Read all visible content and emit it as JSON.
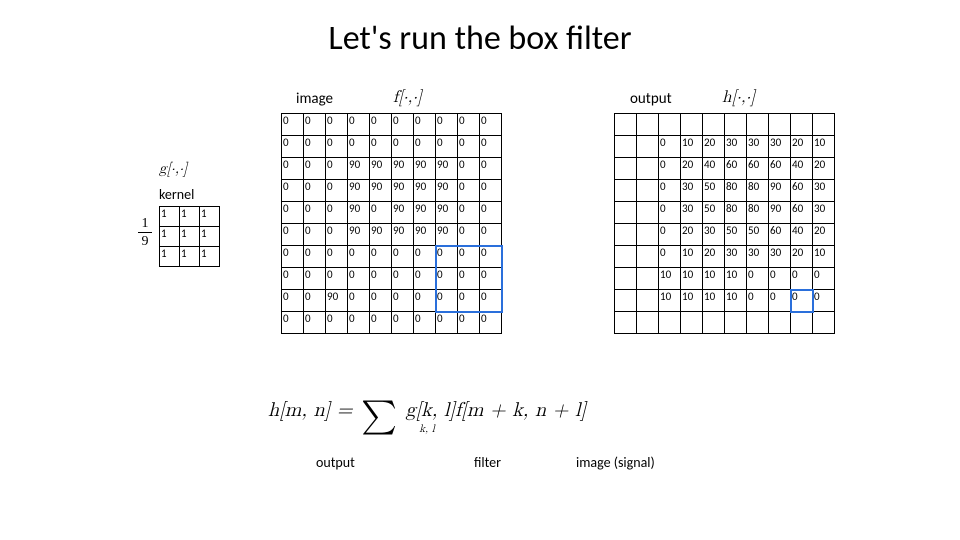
{
  "title": "Let's run the box filter",
  "labels": {
    "image": "image",
    "output": "output",
    "kernel": "kernel",
    "f": "f[·,·]",
    "h": "h[·,·]",
    "g": "g[·,·]",
    "frac_num": "1",
    "frac_den": "9"
  },
  "kernel": [
    [
      1,
      1,
      1
    ],
    [
      1,
      1,
      1
    ],
    [
      1,
      1,
      1
    ]
  ],
  "input_grid": [
    [
      0,
      0,
      0,
      0,
      0,
      0,
      0,
      0,
      0,
      0
    ],
    [
      0,
      0,
      0,
      0,
      0,
      0,
      0,
      0,
      0,
      0
    ],
    [
      0,
      0,
      0,
      90,
      90,
      90,
      90,
      90,
      0,
      0
    ],
    [
      0,
      0,
      0,
      90,
      90,
      90,
      90,
      90,
      0,
      0
    ],
    [
      0,
      0,
      0,
      90,
      0,
      90,
      90,
      90,
      0,
      0
    ],
    [
      0,
      0,
      0,
      90,
      90,
      90,
      90,
      90,
      0,
      0
    ],
    [
      0,
      0,
      0,
      0,
      0,
      0,
      0,
      0,
      0,
      0
    ],
    [
      0,
      0,
      0,
      0,
      0,
      0,
      0,
      0,
      0,
      0
    ],
    [
      0,
      0,
      90,
      0,
      0,
      0,
      0,
      0,
      0,
      0
    ],
    [
      0,
      0,
      0,
      0,
      0,
      0,
      0,
      0,
      0,
      0
    ]
  ],
  "output_grid": [
    [
      null,
      null,
      null,
      null,
      null,
      null,
      null,
      null,
      null,
      null
    ],
    [
      null,
      null,
      0,
      10,
      20,
      30,
      30,
      30,
      20,
      10
    ],
    [
      null,
      null,
      0,
      20,
      40,
      60,
      60,
      60,
      40,
      20
    ],
    [
      null,
      null,
      0,
      30,
      50,
      80,
      80,
      90,
      60,
      30
    ],
    [
      null,
      null,
      0,
      30,
      50,
      80,
      80,
      90,
      60,
      30
    ],
    [
      null,
      null,
      0,
      20,
      30,
      50,
      50,
      60,
      40,
      20
    ],
    [
      null,
      null,
      0,
      10,
      20,
      30,
      30,
      30,
      20,
      10
    ],
    [
      null,
      null,
      10,
      10,
      10,
      10,
      0,
      0,
      0,
      0
    ],
    [
      null,
      null,
      10,
      10,
      10,
      10,
      0,
      0,
      0,
      0
    ],
    [
      null,
      null,
      null,
      null,
      null,
      null,
      null,
      null,
      null,
      null
    ]
  ],
  "equation": {
    "lhs": "h[m, n] =",
    "sum_sub": "k, l",
    "g": "g[k, l]",
    "f": "f[m + k, n + l]"
  },
  "captions": {
    "output": "output",
    "filter": "filter",
    "image_signal": "image (signal)"
  },
  "chart_data": {
    "type": "table",
    "title": "Box filter convolution example",
    "kernel_scale": "1/9",
    "kernel": [
      [
        1,
        1,
        1
      ],
      [
        1,
        1,
        1
      ],
      [
        1,
        1,
        1
      ]
    ],
    "input": [
      [
        0,
        0,
        0,
        0,
        0,
        0,
        0,
        0,
        0,
        0
      ],
      [
        0,
        0,
        0,
        0,
        0,
        0,
        0,
        0,
        0,
        0
      ],
      [
        0,
        0,
        0,
        90,
        90,
        90,
        90,
        90,
        0,
        0
      ],
      [
        0,
        0,
        0,
        90,
        90,
        90,
        90,
        90,
        0,
        0
      ],
      [
        0,
        0,
        0,
        90,
        0,
        90,
        90,
        90,
        0,
        0
      ],
      [
        0,
        0,
        0,
        90,
        90,
        90,
        90,
        90,
        0,
        0
      ],
      [
        0,
        0,
        0,
        0,
        0,
        0,
        0,
        0,
        0,
        0
      ],
      [
        0,
        0,
        0,
        0,
        0,
        0,
        0,
        0,
        0,
        0
      ],
      [
        0,
        0,
        90,
        0,
        0,
        0,
        0,
        0,
        0,
        0
      ],
      [
        0,
        0,
        0,
        0,
        0,
        0,
        0,
        0,
        0,
        0
      ]
    ],
    "output_partial": [
      [
        null,
        null,
        null,
        null,
        null,
        null,
        null,
        null,
        null,
        null
      ],
      [
        null,
        null,
        0,
        10,
        20,
        30,
        30,
        30,
        20,
        10
      ],
      [
        null,
        null,
        0,
        20,
        40,
        60,
        60,
        60,
        40,
        20
      ],
      [
        null,
        null,
        0,
        30,
        50,
        80,
        80,
        90,
        60,
        30
      ],
      [
        null,
        null,
        0,
        30,
        50,
        80,
        80,
        90,
        60,
        30
      ],
      [
        null,
        null,
        0,
        20,
        30,
        50,
        50,
        60,
        40,
        20
      ],
      [
        null,
        null,
        0,
        10,
        20,
        30,
        30,
        30,
        20,
        10
      ],
      [
        null,
        null,
        10,
        10,
        10,
        10,
        0,
        0,
        0,
        0
      ],
      [
        null,
        null,
        10,
        10,
        10,
        10,
        0,
        0,
        0,
        0
      ],
      [
        null,
        null,
        null,
        null,
        null,
        null,
        null,
        null,
        null,
        null
      ]
    ],
    "input_highlight": {
      "row_start": 6,
      "col_start": 7,
      "rows": 3,
      "cols": 3
    },
    "output_highlight": {
      "row": 8,
      "col": 8
    }
  }
}
